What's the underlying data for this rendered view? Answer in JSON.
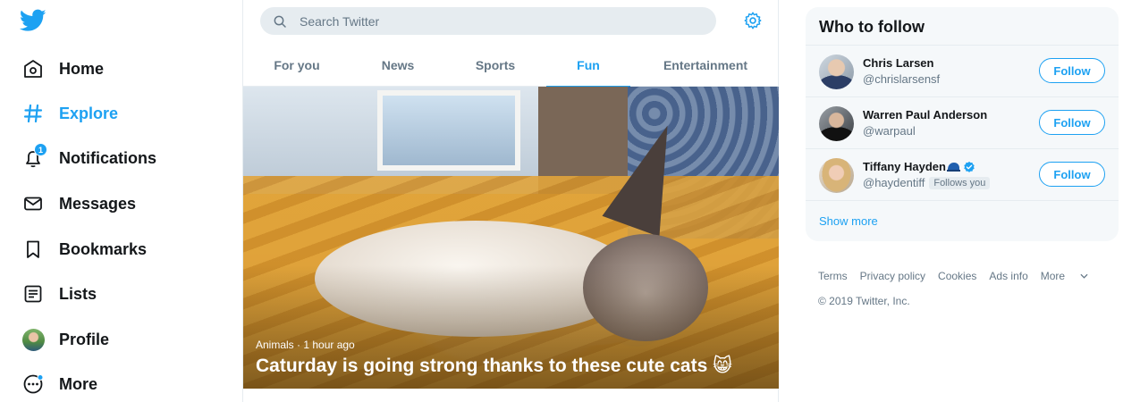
{
  "nav": {
    "logo_icon": "twitter-bird-icon",
    "items": [
      {
        "label": "Home",
        "icon": "home-icon"
      },
      {
        "label": "Explore",
        "icon": "hashtag-icon"
      },
      {
        "label": "Notifications",
        "icon": "bell-icon",
        "badge": "1"
      },
      {
        "label": "Messages",
        "icon": "envelope-icon"
      },
      {
        "label": "Bookmarks",
        "icon": "bookmark-icon"
      },
      {
        "label": "Lists",
        "icon": "list-icon"
      },
      {
        "label": "Profile",
        "icon": "avatar"
      },
      {
        "label": "More",
        "icon": "more-icon"
      }
    ],
    "active": "Explore"
  },
  "search": {
    "placeholder": "Search Twitter",
    "value": ""
  },
  "tabs": {
    "items": [
      {
        "label": "For you"
      },
      {
        "label": "News"
      },
      {
        "label": "Sports"
      },
      {
        "label": "Fun"
      },
      {
        "label": "Entertainment"
      }
    ],
    "active": "Fun"
  },
  "hero": {
    "meta": "Animals · 1 hour ago",
    "title": "Caturday is going strong thanks to these cute cats 😸"
  },
  "who_to_follow": {
    "title": "Who to follow",
    "users": [
      {
        "name": "Chris Larsen",
        "handle": "@chrislarsensf",
        "button": "Follow"
      },
      {
        "name": "Warren Paul Anderson",
        "handle": "@warpaul",
        "button": "Follow"
      },
      {
        "name": "Tiffany Hayden",
        "handle": "@haydentiff",
        "follows_you": "Follows you",
        "button": "Follow",
        "verified": true
      }
    ],
    "show_more": "Show more"
  },
  "footer": {
    "links": [
      "Terms",
      "Privacy policy",
      "Cookies",
      "Ads info",
      "More"
    ],
    "copyright": "© 2019 Twitter, Inc."
  },
  "colors": {
    "accent": "#1da1f2",
    "text": "#14171a",
    "muted": "#657786",
    "border": "#e6ecf0",
    "panel": "#f5f8fa"
  }
}
